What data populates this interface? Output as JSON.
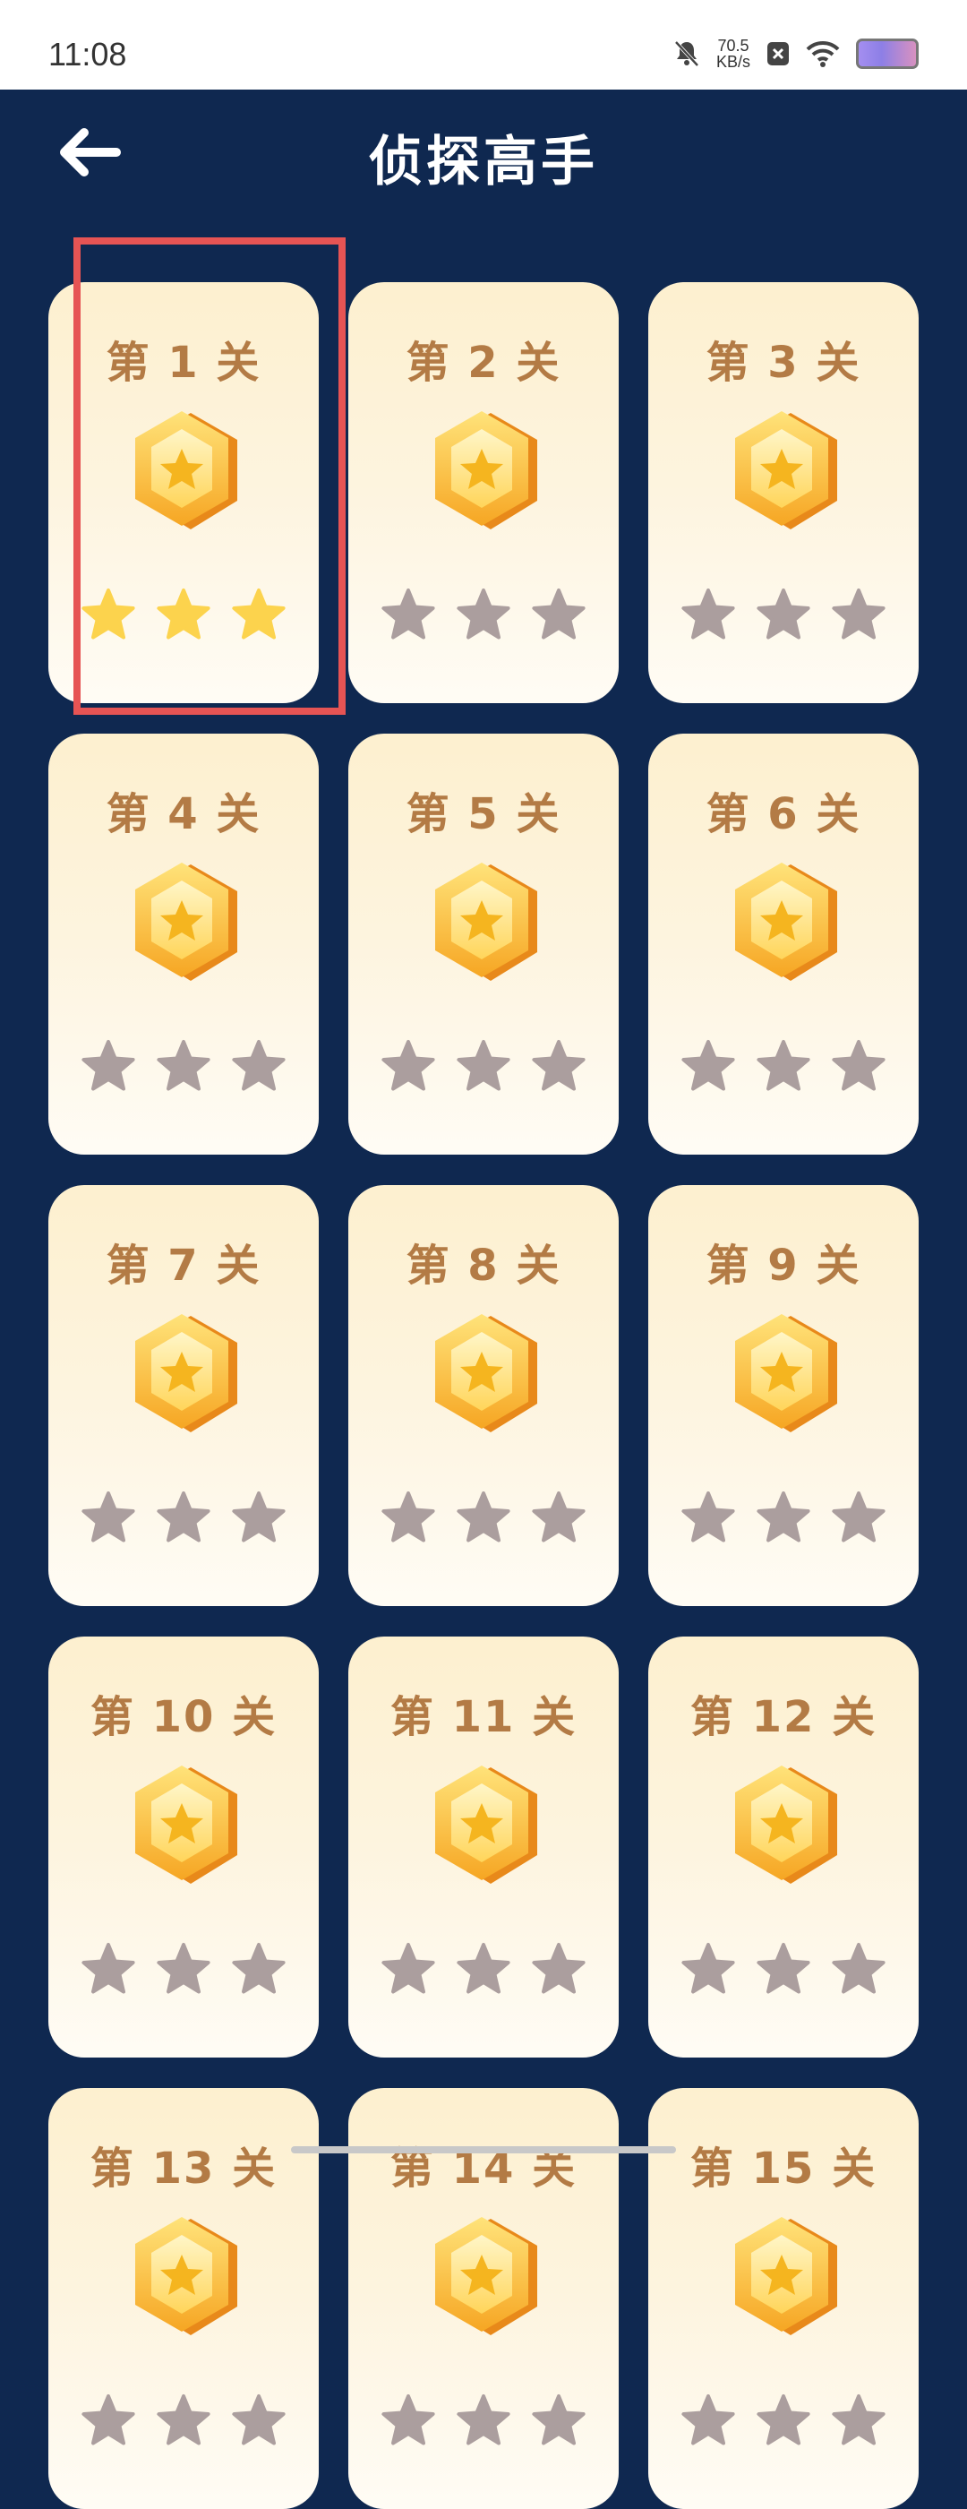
{
  "status_bar": {
    "time": "11:08",
    "net_speed_value": "70.5",
    "net_speed_unit": "KB/s",
    "icons": [
      "bell-off-icon",
      "close-box-icon",
      "wifi-icon",
      "battery-icon"
    ]
  },
  "header": {
    "title": "侦探高手",
    "back_icon": "arrow-left-icon"
  },
  "colors": {
    "background": "#0f2850",
    "card_top": "#fdf0cf",
    "card_bottom": "#fffcf5",
    "title_text": "#b37b45",
    "star_earned": "#fcd34d",
    "star_empty": "#ab9e9e",
    "highlight": "#e65454"
  },
  "levels": [
    {
      "label": "第 1 关",
      "stars_earned": 3,
      "stars_total": 3,
      "highlighted": true
    },
    {
      "label": "第 2 关",
      "stars_earned": 0,
      "stars_total": 3
    },
    {
      "label": "第 3 关",
      "stars_earned": 0,
      "stars_total": 3
    },
    {
      "label": "第 4 关",
      "stars_earned": 0,
      "stars_total": 3
    },
    {
      "label": "第 5 关",
      "stars_earned": 0,
      "stars_total": 3
    },
    {
      "label": "第 6 关",
      "stars_earned": 0,
      "stars_total": 3
    },
    {
      "label": "第 7 关",
      "stars_earned": 0,
      "stars_total": 3
    },
    {
      "label": "第 8 关",
      "stars_earned": 0,
      "stars_total": 3
    },
    {
      "label": "第 9 关",
      "stars_earned": 0,
      "stars_total": 3
    },
    {
      "label": "第 10 关",
      "stars_earned": 0,
      "stars_total": 3
    },
    {
      "label": "第 11 关",
      "stars_earned": 0,
      "stars_total": 3
    },
    {
      "label": "第 12 关",
      "stars_earned": 0,
      "stars_total": 3
    },
    {
      "label": "第 13 关",
      "stars_earned": 0,
      "stars_total": 3
    },
    {
      "label": "第 14 关",
      "stars_earned": 0,
      "stars_total": 3
    },
    {
      "label": "第 15 关",
      "stars_earned": 0,
      "stars_total": 3
    }
  ]
}
